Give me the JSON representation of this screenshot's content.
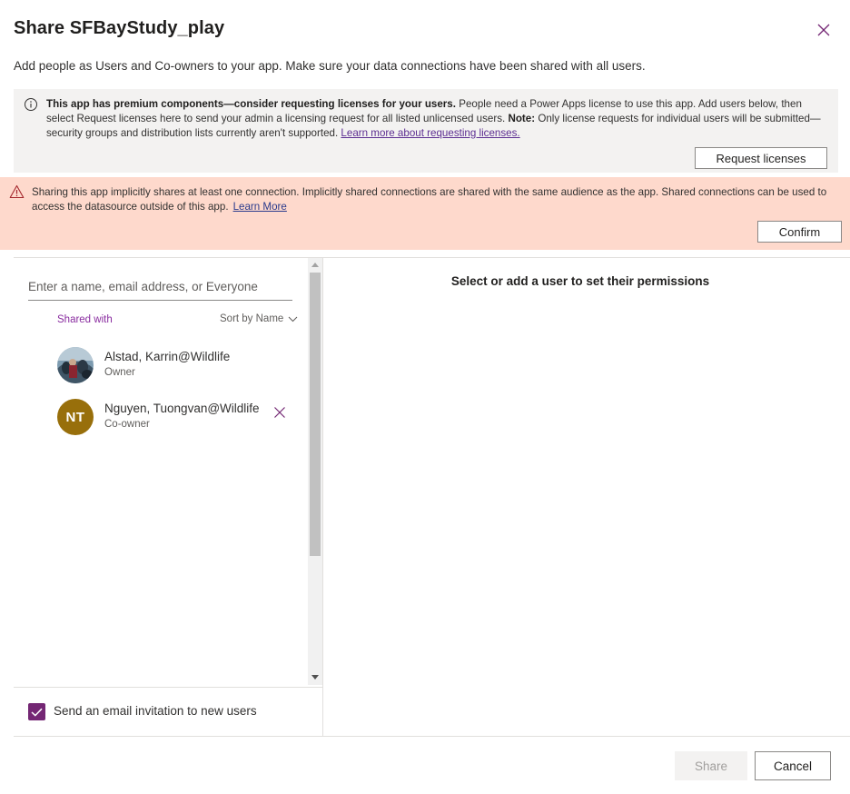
{
  "dialog": {
    "title": "Share SFBayStudy_play",
    "subtitle": "Add people as Users and Co-owners to your app. Make sure your data connections have been shared with all users."
  },
  "license_notice": {
    "icon": "info-icon",
    "bold_text": "This app has premium components—consider requesting licenses for your users.",
    "text_1": " People need a Power Apps license to use this app. Add users below, then select Request licenses here to send your admin a licensing request for all listed unlicensed users. ",
    "note_label": "Note:",
    "text_2": " Only license requests for individual users will be submitted—security groups and distribution lists currently aren't supported. ",
    "link": "Learn more about requesting licenses.",
    "button": "Request licenses"
  },
  "warning": {
    "icon": "warning-icon",
    "text": "Sharing this app implicitly shares at least one connection. Implicitly shared connections are shared with the same audience as the app. Shared connections can be used to access the datasource outside of this app.",
    "link": "Learn More",
    "button": "Confirm",
    "background": "#fed9cc"
  },
  "search": {
    "placeholder": "Enter a name, email address, or Everyone"
  },
  "list": {
    "header": "Shared with",
    "sort_label": "Sort by Name",
    "users": [
      {
        "name": "Alstad, Karrin@Wildlife",
        "role": "Owner",
        "avatar": "photo"
      },
      {
        "name": "Nguyen, Tuongvan@Wildlife",
        "role": "Co-owner",
        "initials": "NT",
        "avatar_color": "#986f0b"
      }
    ]
  },
  "permissions": {
    "message": "Select or add a user to set their permissions"
  },
  "email_invite": {
    "label": "Send an email invitation to new users",
    "checked": true,
    "color": "#742774"
  },
  "footer": {
    "share": "Share",
    "cancel": "Cancel"
  },
  "accent": "#742774"
}
